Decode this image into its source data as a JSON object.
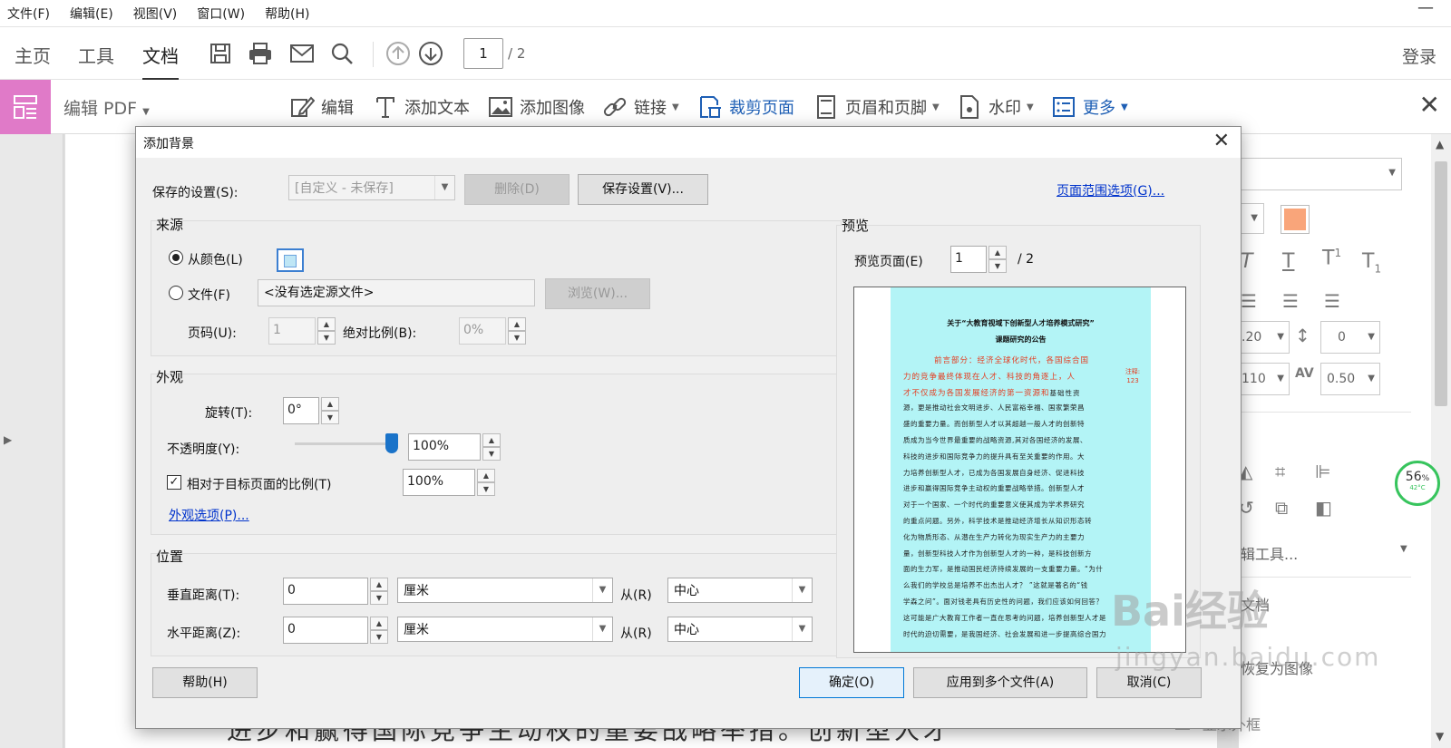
{
  "menubar": {
    "items": [
      "文件(F)",
      "编辑(E)",
      "视图(V)",
      "窗口(W)",
      "帮助(H)"
    ],
    "close_label": "—"
  },
  "toolbar": {
    "tabs": [
      "主页",
      "工具",
      "文档"
    ],
    "active_tab": "文档",
    "page_current": "1",
    "page_total": "/ 2",
    "login_label": "登录"
  },
  "edit_bar": {
    "title": "编辑 PDF",
    "tools": [
      {
        "label": "编辑",
        "icon": "edit-icon"
      },
      {
        "label": "添加文本",
        "icon": "text-icon"
      },
      {
        "label": "添加图像",
        "icon": "image-icon"
      },
      {
        "label": "链接",
        "icon": "link-icon"
      },
      {
        "label": "裁剪页面",
        "icon": "crop-icon"
      },
      {
        "label": "页眉和页脚",
        "icon": "header-footer-icon"
      },
      {
        "label": "水印",
        "icon": "watermark-icon"
      },
      {
        "label": "更多",
        "icon": "more-icon"
      }
    ]
  },
  "document": {
    "visible_text": "进步和赢得国际竞争主动权的重要战略举措。创新型人才"
  },
  "right_panel": {
    "spacing_value": "0",
    "scale_value_1": ".20",
    "scale_value_2": "110",
    "tracking_value": "0.50",
    "edit_tools_label": "辑工具...",
    "restore_label": "恢复为图像",
    "border_label": "显示外框",
    "text_label": "文档",
    "swatch_color": "#f9a57a"
  },
  "percent_widget": {
    "value": "56",
    "unit": "%",
    "temp": "42°C"
  },
  "dialog": {
    "title": "添加背景",
    "saved_settings_label": "保存的设置(S):",
    "saved_settings_value": "[自定义 - 未保存]",
    "delete_button": "删除(D)",
    "save_settings_button": "保存设置(V)...",
    "page_range_link": "页面范围选项(G)...",
    "source": {
      "title": "来源",
      "from_color_label": "从颜色(L)",
      "file_label": "文件(F)",
      "file_value": "<没有选定源文件>",
      "browse_button": "浏览(W)...",
      "page_label": "页码(U):",
      "page_value": "1",
      "abs_scale_label": "绝对比例(B):",
      "abs_scale_value": "0%"
    },
    "appearance": {
      "title": "外观",
      "rotation_label": "旋转(T):",
      "rotation_value": "0°",
      "opacity_label": "不透明度(Y):",
      "opacity_value": "100%",
      "relative_scale_label": "相对于目标页面的比例(T)",
      "relative_scale_value": "100%",
      "appearance_options_link": "外观选项(P)..."
    },
    "position": {
      "title": "位置",
      "vertical_label": "垂直距离(T):",
      "vertical_value": "0",
      "vertical_unit": "厘米",
      "vertical_from_label": "从(R)",
      "vertical_from_value": "中心",
      "horizontal_label": "水平距离(Z):",
      "horizontal_value": "0",
      "horizontal_unit": "厘米",
      "horizontal_from_label": "从(R)",
      "horizontal_from_value": "中心"
    },
    "preview": {
      "title": "预览",
      "page_label": "预览页面(E)",
      "page_value": "1",
      "page_total": "/ 2",
      "background_color": "#b3f4f6",
      "doc_title_1": "关于“大教育视域下创新型人才培养模式研究”",
      "doc_title_2": "课题研究的公告",
      "note": "注释: 123",
      "lines": [
        "前言部分：经济全球化时代，各国综合国",
        "力的竞争最终体现在人才、科技的角逐上，人",
        "才不仅成为各国发展经济的第一资源和基础性资",
        "源，更是推动社会文明进步、人民富裕幸福、国家繁荣昌",
        "盛的重要力量。而创新型人才以其超越一般人才的创新特",
        "质成为当今世界最重要的战略资源,其对各国经济的发展、",
        "科技的进步和国际竞争力的提升具有至关重要的作用。大",
        "力培养创新型人才，已成为各国发展自身经济、促进科技",
        "进步和赢得国际竞争主动权的重要战略举措。创新型人才",
        "对于一个国家、一个时代的重要意义使其成为学术界研究",
        "的重点问题。另外，科学技术是推动经济增长从知识形态转",
        "化为物质形态、从潜在生产力转化为现实生产力的主要力",
        "量，创新型科技人才作为创新型人才的一种，是科技创新方",
        "面的生力军，是推动国民经济持续发展的一支重要力量。“为什",
        "么我们的学校总是培养不出杰出人才？ ”这就是著名的“钱",
        "学森之问”。面对钱老具有历史性的问题，我们应该如何回答？",
        "这可能是广大教育工作者一直在思考的问题，培养创新型人才是",
        "时代的迫切需要，是我国经济、社会发展和进一步提高综合国力"
      ]
    },
    "help_button": "帮助(H)",
    "ok_button": "确定(O)",
    "apply_multiple_button": "应用到多个文件(A)",
    "cancel_button": "取消(C)"
  },
  "watermark": {
    "text": "Bai经验",
    "sub": "jingyan.baidu.com"
  }
}
